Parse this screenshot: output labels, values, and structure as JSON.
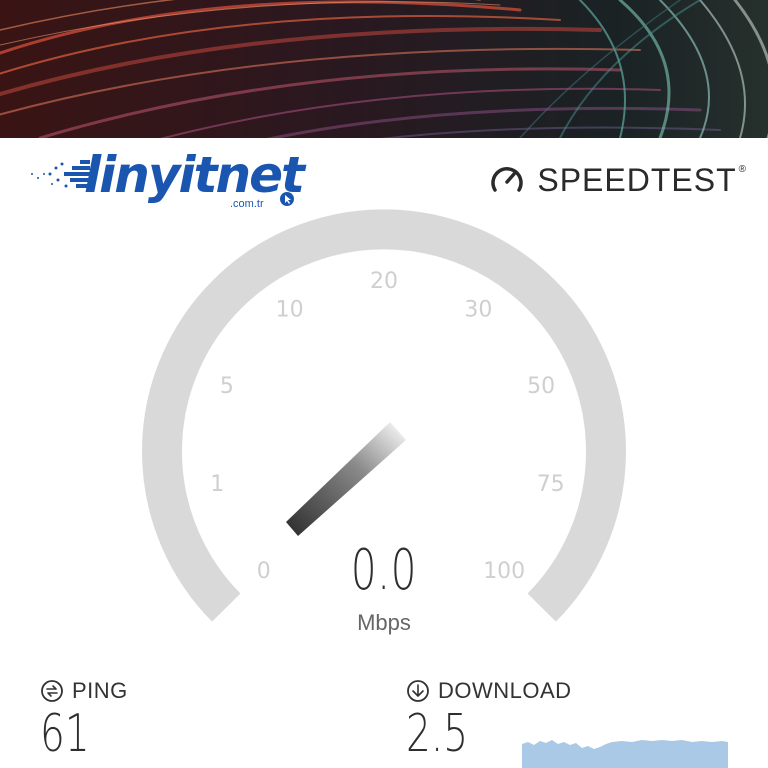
{
  "header": {
    "brand_name": "linyitnet",
    "brand_domain": ".com.tr",
    "speedtest_label": "SPEEDTEST",
    "speedtest_trademark": "®"
  },
  "gauge": {
    "tick_labels": [
      "0",
      "1",
      "5",
      "10",
      "20",
      "30",
      "50",
      "75",
      "100"
    ],
    "needle_value": 0.0,
    "speed_value": "0.0",
    "unit": "Mbps"
  },
  "stats": {
    "ping": {
      "label": "PING",
      "value": "61",
      "icon": "ping-icon"
    },
    "download": {
      "label": "DOWNLOAD",
      "value": "2.5",
      "icon": "download-icon"
    }
  },
  "colors": {
    "gauge_track": "#d9d9d9",
    "tick_label": "#cfcfcf",
    "brand_blue": "#1a56b0",
    "graph_fill": "#a9c9e6"
  }
}
